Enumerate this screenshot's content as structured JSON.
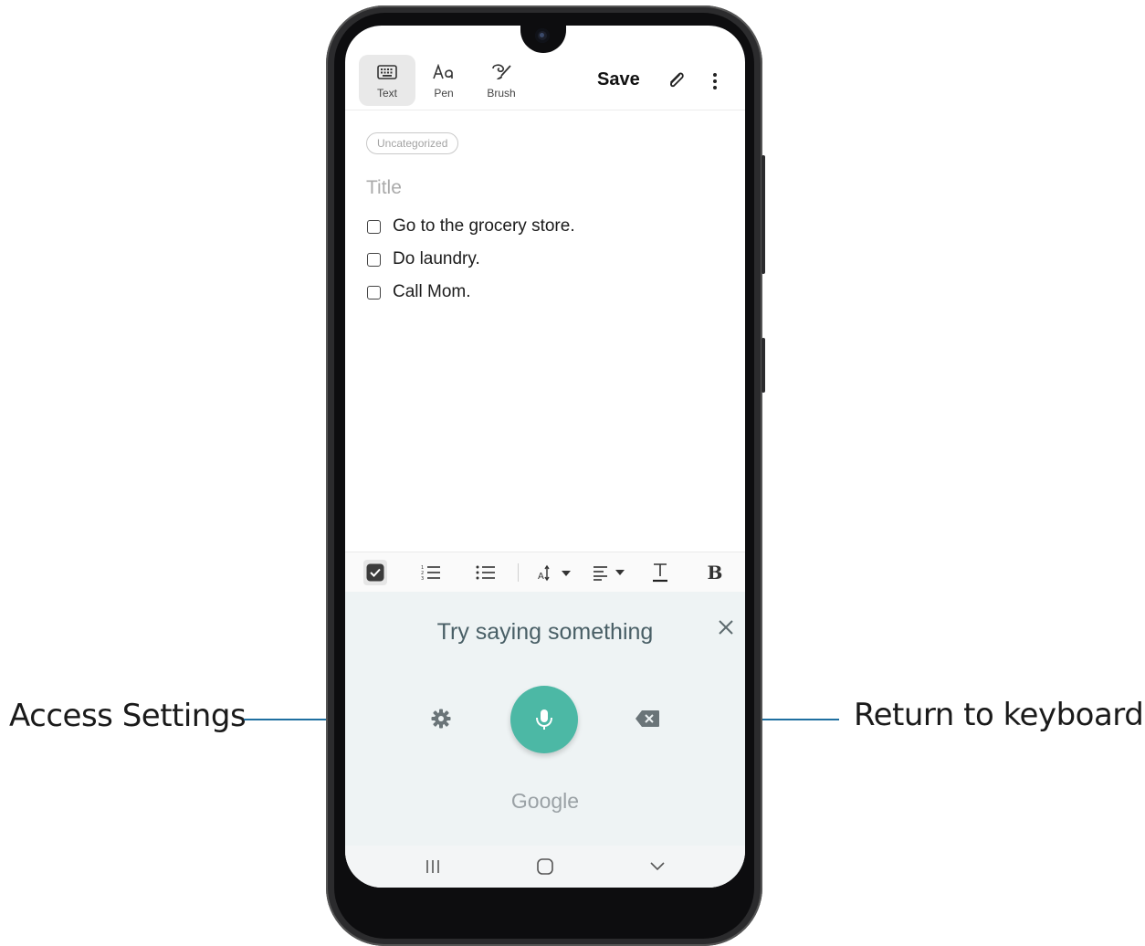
{
  "callouts": {
    "left": "Access Settings",
    "right": "Return to keyboard"
  },
  "toolbar": {
    "modes": [
      {
        "label": "Text",
        "icon": "keyboard-icon",
        "active": true
      },
      {
        "label": "Pen",
        "icon": "pen-text-icon",
        "active": false
      },
      {
        "label": "Brush",
        "icon": "brush-icon",
        "active": false
      }
    ],
    "save_label": "Save",
    "attach_icon": "paperclip-icon",
    "more_icon": "more-vertical-icon"
  },
  "note": {
    "category": "Uncategorized",
    "title_placeholder": "Title",
    "checklist": [
      {
        "text": "Go to the grocery store.",
        "checked": false
      },
      {
        "text": "Do laundry.",
        "checked": false
      },
      {
        "text": "Call Mom.",
        "checked": false
      }
    ]
  },
  "format_bar": {
    "items": [
      "checkbox-icon",
      "numbered-list-icon",
      "bullet-list-icon",
      "font-size-icon",
      "align-icon",
      "underline-icon",
      "bold-icon"
    ],
    "bold_glyph": "B"
  },
  "voice_input": {
    "prompt": "Try saying something",
    "brand": "Google",
    "mic_color": "#4cb8a5",
    "background": "#eef3f4"
  },
  "nav_bar": {
    "buttons": [
      "recent-apps-icon",
      "home-icon",
      "hide-keyboard-icon"
    ]
  },
  "colors": {
    "callout_line": "#1f6fa0"
  }
}
